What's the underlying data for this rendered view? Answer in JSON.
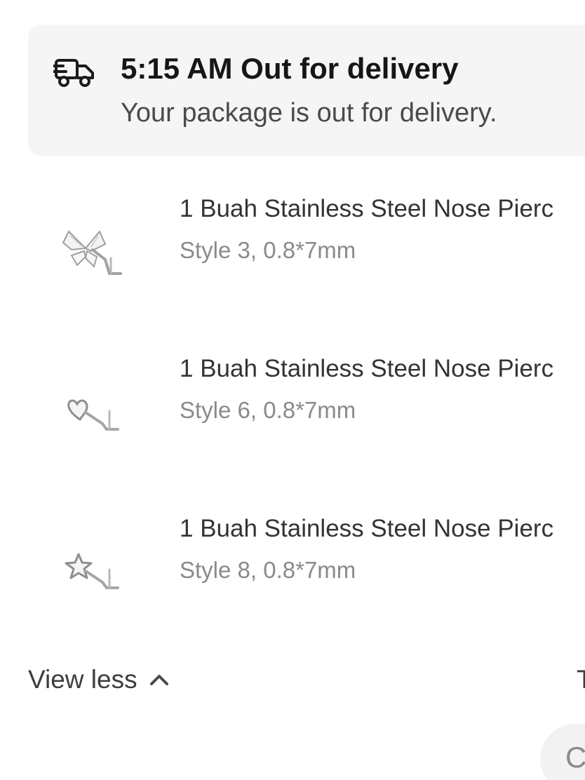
{
  "delivery_status": {
    "icon": "truck-icon",
    "title": "5:15 AM Out for delivery",
    "description": "Your package is out for delivery."
  },
  "items": [
    {
      "name": "1 Buah Stainless Steel Nose Pierc",
      "variant": "Style 3, 0.8*7mm",
      "thumbnail": "butterfly-nose-stud"
    },
    {
      "name": "1 Buah Stainless Steel Nose Pierc",
      "variant": "Style 6, 0.8*7mm",
      "thumbnail": "heart-nose-stud"
    },
    {
      "name": "1 Buah Stainless Steel Nose Pierc",
      "variant": "Style 8, 0.8*7mm",
      "thumbnail": "star-nose-stud"
    }
  ],
  "footer": {
    "view_less_label": "View less",
    "view_less_icon": "chevron-up-icon",
    "right_edge_text": "T",
    "bottom_button_text": "C"
  },
  "colors": {
    "card_background": "#f5f5f5",
    "primary_text": "#161616",
    "secondary_text": "#8a8a8a"
  }
}
